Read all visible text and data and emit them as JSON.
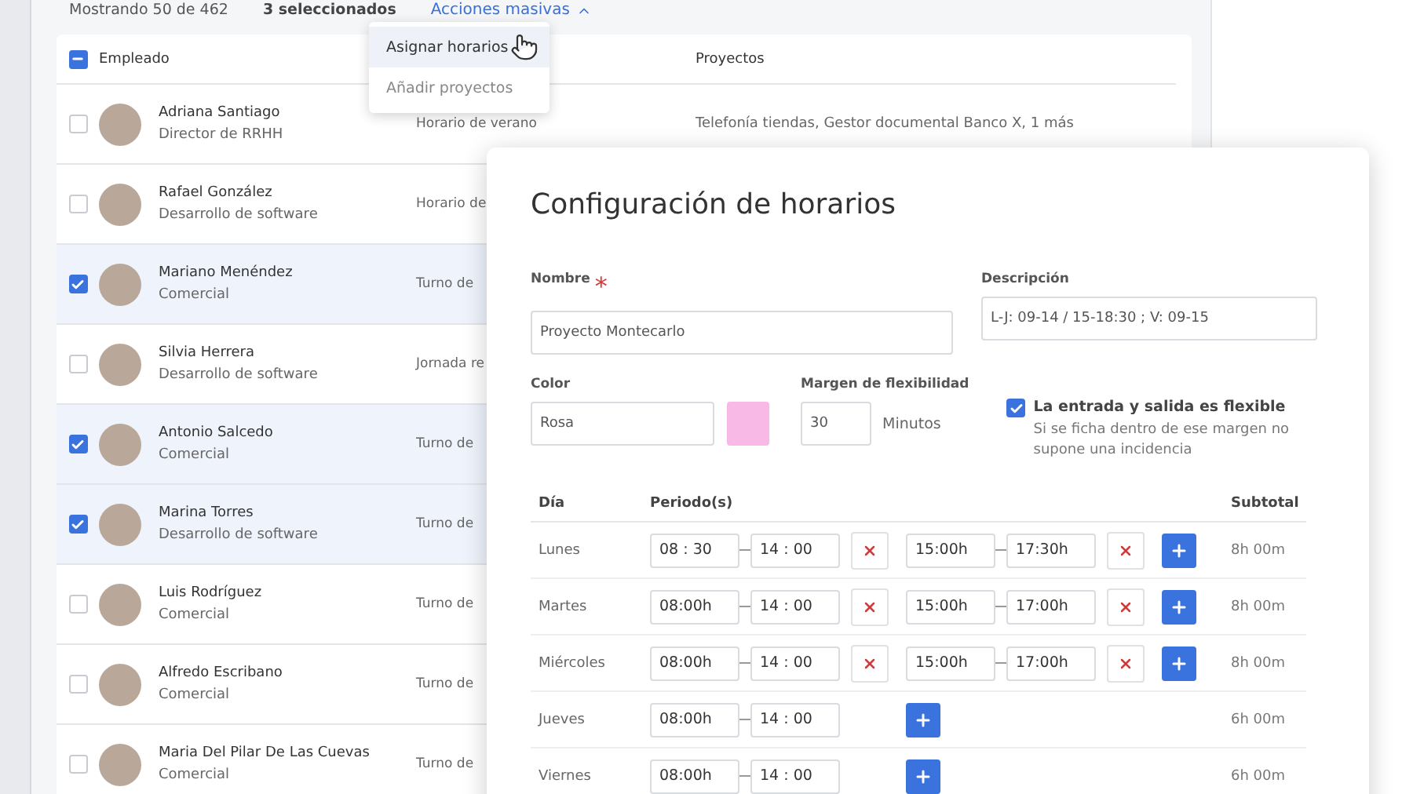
{
  "toolbar": {
    "count": "Mostrando 50 de 462",
    "selected_count": "3 seleccionados",
    "bulk_actions": {
      "label": "Acciones masivas",
      "expanded": true
    }
  },
  "bulk_menu": [
    {
      "label": "Asignar horarios",
      "selected": true
    },
    {
      "label": "Añadir proyectos",
      "selected": false
    }
  ],
  "table": {
    "header_checkbox": {
      "indeterminate": true
    },
    "columns": {
      "employee": "Empleado",
      "projects": "Proyectos"
    },
    "rows": [
      {
        "name": "Adriana Santiago",
        "role": "Director de RRHH",
        "schedule": "Horario de verano",
        "projects": "Telefonía tiendas, Gestor documental Banco X, 1 más",
        "selected": false
      },
      {
        "name": "Rafael González",
        "role": "Desarrollo de software",
        "schedule": "Horario de",
        "selected": false
      },
      {
        "name": "Mariano Menéndez",
        "role": "Comercial",
        "schedule": "Turno de",
        "selected": true
      },
      {
        "name": "Silvia Herrera",
        "role": "Desarrollo de software",
        "schedule": "Jornada re",
        "selected": false
      },
      {
        "name": "Antonio Salcedo",
        "role": "Comercial",
        "schedule": "Turno de",
        "selected": true
      },
      {
        "name": "Marina Torres",
        "role": "Desarrollo de software",
        "schedule": "Turno de",
        "selected": true
      },
      {
        "name": "Luis Rodríguez",
        "role": "Comercial",
        "schedule": "Turno de",
        "selected": false
      },
      {
        "name": "Alfredo Escribano",
        "role": "Comercial",
        "schedule": "Turno de",
        "selected": false
      },
      {
        "name": "Maria Del Pilar De Las Cuevas",
        "role": "Comercial",
        "schedule": "Turno de",
        "selected": false
      }
    ]
  },
  "modal": {
    "title": "Configuración de horarios",
    "name_field": {
      "label": "Nombre",
      "required_marker": "*",
      "value": "Proyecto Montecarlo"
    },
    "description_field": {
      "label": "Descripción",
      "value": "L-J: 09-14 / 15-18:30 ; V: 09-15"
    },
    "color_field": {
      "label": "Color",
      "value": "Rosa",
      "color": "#f9b9e6"
    },
    "flex_field": {
      "label": "Margen de flexibilidad",
      "value": "30",
      "unit": "Minutos"
    },
    "flexible": {
      "label": "La entrada y salida es flexible",
      "help": "Si se ficha dentro de ese margen no supone una incidencia",
      "checked": true
    },
    "schedule": {
      "columns": {
        "day": "Día",
        "periods": "Periodo(s)",
        "subtotal": "Subtotal"
      },
      "days": [
        {
          "day": "Lunes",
          "periods": [
            {
              "start": "08 : 30",
              "end": "14 : 00",
              "removable": true
            },
            {
              "start": "15:00h",
              "end": "17:30h",
              "removable": true
            }
          ],
          "subtotal": "8h 00m"
        },
        {
          "day": "Martes",
          "periods": [
            {
              "start": "08:00h",
              "end": "14 : 00",
              "removable": true
            },
            {
              "start": "15:00h",
              "end": "17:00h",
              "removable": true
            }
          ],
          "subtotal": "8h 00m"
        },
        {
          "day": "Miércoles",
          "periods": [
            {
              "start": "08:00h",
              "end": "14 : 00",
              "removable": true
            },
            {
              "start": "15:00h",
              "end": "17:00h",
              "removable": true
            }
          ],
          "subtotal": "8h 00m"
        },
        {
          "day": "Jueves",
          "periods": [
            {
              "start": "08:00h",
              "end": "14 : 00",
              "removable": false
            }
          ],
          "subtotal": "6h 00m"
        },
        {
          "day": "Viernes",
          "periods": [
            {
              "start": "08:00h",
              "end": "14 : 00",
              "removable": false
            }
          ],
          "subtotal": "6h 00m"
        }
      ]
    }
  }
}
